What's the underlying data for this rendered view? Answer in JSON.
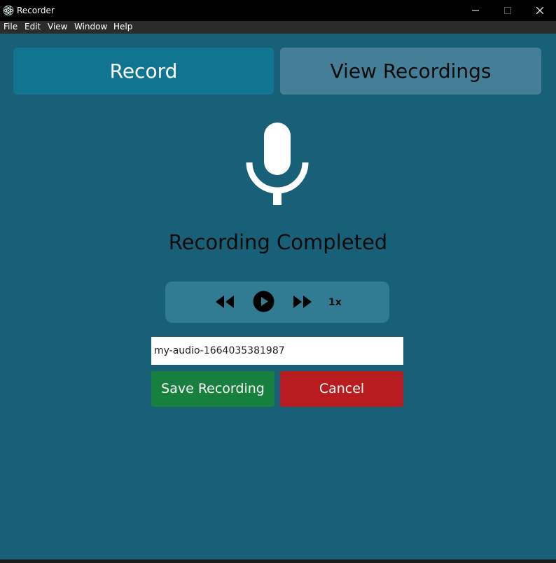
{
  "window": {
    "title": "Recorder"
  },
  "menu": [
    "File",
    "Edit",
    "View",
    "Window",
    "Help"
  ],
  "tabs": {
    "record": "Record",
    "view_recordings": "View Recordings"
  },
  "status": "Recording Completed",
  "player": {
    "speed": "1x"
  },
  "filename": {
    "value": "my-audio-1664035381987"
  },
  "actions": {
    "save": "Save Recording",
    "cancel": "Cancel"
  },
  "icons": {
    "app": "electron-icon",
    "mic": "microphone-icon",
    "rewind": "rewind-icon",
    "play": "play-icon",
    "fast_forward": "fast-forward-icon"
  },
  "colors": {
    "background": "#186078",
    "tab_active": "#117491",
    "tab_inactive": "#447f97",
    "player_bg": "#317c93",
    "save": "#18803f",
    "cancel": "#b81c1f"
  }
}
